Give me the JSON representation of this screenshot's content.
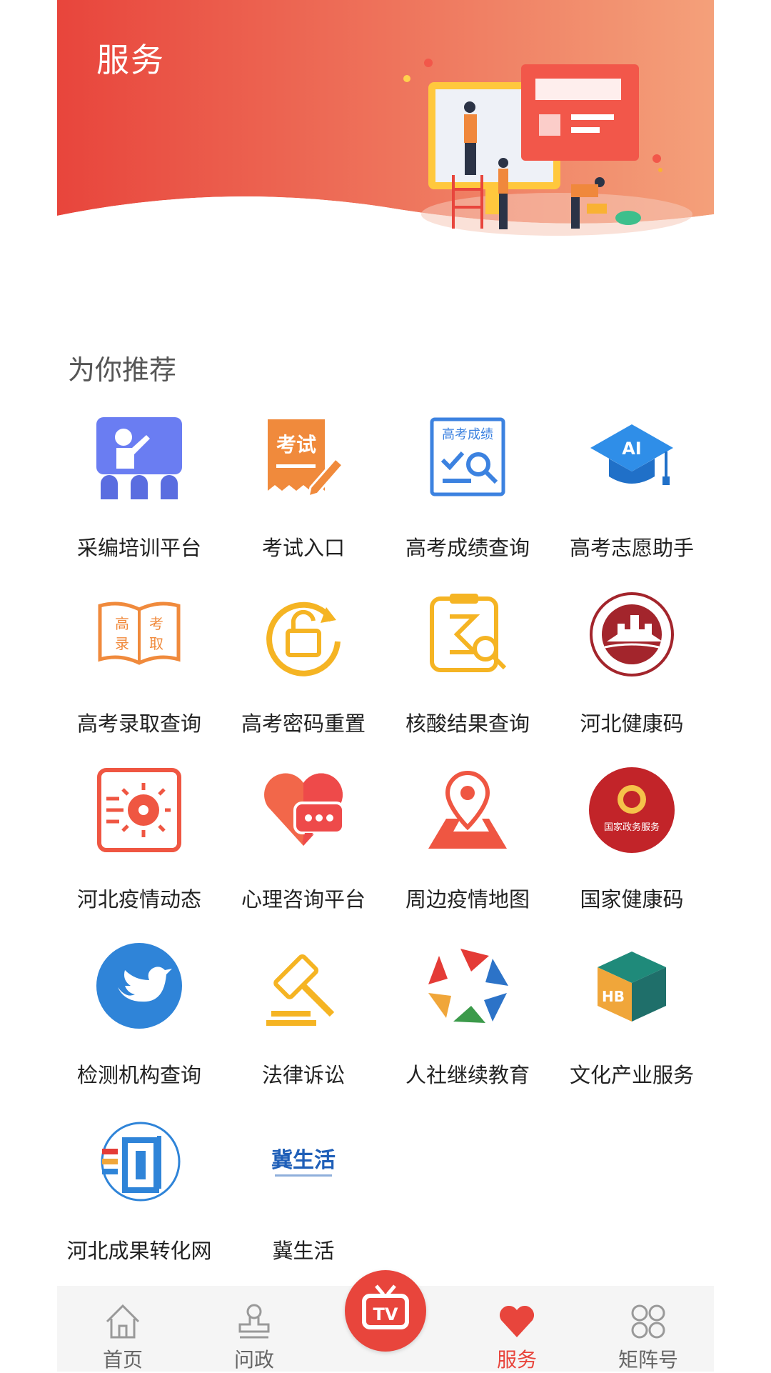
{
  "header": {
    "title": "服务"
  },
  "section": {
    "title": "为你推荐"
  },
  "services": [
    {
      "label": "采编培训平台",
      "icon": "training-classroom-icon"
    },
    {
      "label": "考试入口",
      "icon": "exam-pen-icon"
    },
    {
      "label": "高考成绩查询",
      "icon": "score-check-icon",
      "icon_text": "高考成绩"
    },
    {
      "label": "高考志愿助手",
      "icon": "ai-graduation-cap-icon",
      "icon_text": "AI"
    },
    {
      "label": "高考录取查询",
      "icon": "admission-book-icon",
      "icon_text": [
        "高",
        "考",
        "录",
        "取"
      ]
    },
    {
      "label": "高考密码重置",
      "icon": "password-reset-lock-icon"
    },
    {
      "label": "核酸结果查询",
      "icon": "nucleic-test-search-icon"
    },
    {
      "label": "河北健康码",
      "icon": "hebei-great-wall-seal-icon"
    },
    {
      "label": "河北疫情动态",
      "icon": "virus-icon"
    },
    {
      "label": "心理咨询平台",
      "icon": "heart-chat-icon"
    },
    {
      "label": "周边疫情地图",
      "icon": "map-pin-icon"
    },
    {
      "label": "国家健康码",
      "icon": "national-emblem-icon",
      "icon_text": "国家政务服务"
    },
    {
      "label": "检测机构查询",
      "icon": "bird-circle-icon"
    },
    {
      "label": "法律诉讼",
      "icon": "gavel-icon"
    },
    {
      "label": "人社继续教育",
      "icon": "colorful-pentagon-icon"
    },
    {
      "label": "文化产业服务",
      "icon": "culture-cube-icon"
    },
    {
      "label": "河北成果转化网",
      "icon": "globe-logo-icon"
    },
    {
      "label": "冀生活",
      "icon": "ji-life-logo-icon",
      "icon_text": "冀生活"
    }
  ],
  "nav": [
    {
      "label": "首页",
      "icon": "home-icon"
    },
    {
      "label": "问政",
      "icon": "stamp-icon"
    },
    {
      "label": "",
      "icon": "tv-icon"
    },
    {
      "label": "服务",
      "icon": "heart-icon",
      "active": true
    },
    {
      "label": "矩阵号",
      "icon": "clover-grid-icon"
    }
  ],
  "colors": {
    "accent": "#e8453c",
    "banner_start": "#e8453c",
    "banner_end": "#f4a07a"
  }
}
